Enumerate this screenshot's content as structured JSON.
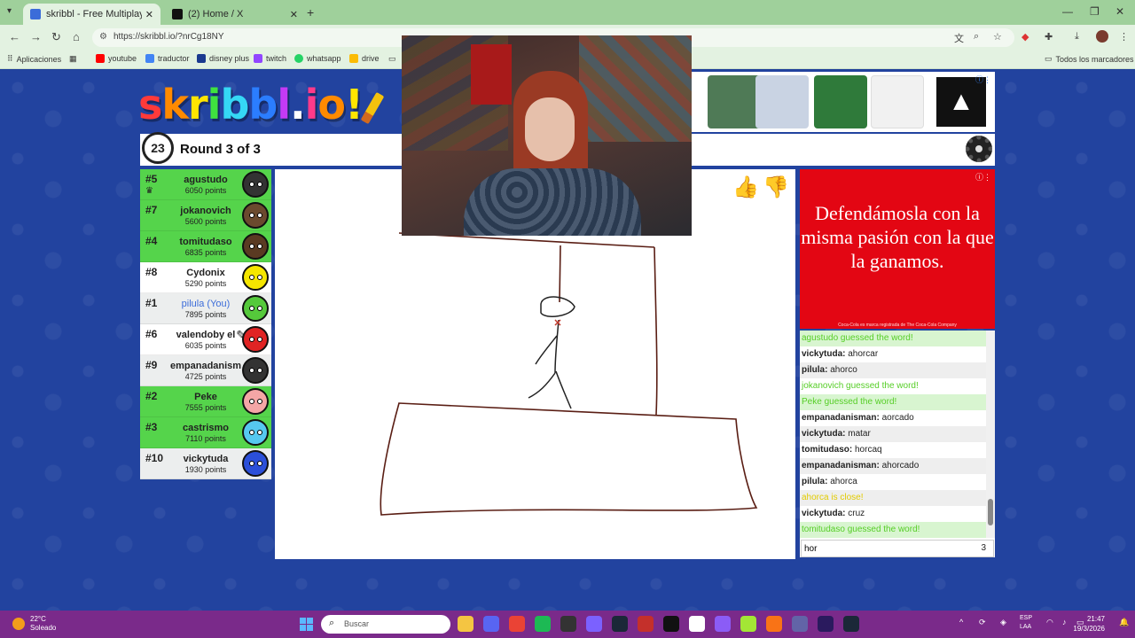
{
  "browser": {
    "tabs": [
      {
        "title": "skribbl - Free Multiplayer D",
        "active": true,
        "icon": "skribbl-favicon"
      },
      {
        "title": "(2) Home / X",
        "active": false,
        "icon": "x-favicon"
      }
    ],
    "new_tab": "+",
    "url": "https://skribbl.io/?nrCg18NY",
    "bookmarks": [
      {
        "label": "Aplicaciones",
        "icon": "apps-icon"
      },
      {
        "label": "youtube",
        "icon": "youtube-icon",
        "color": "#ff0000"
      },
      {
        "label": "traductor",
        "icon": "translate-icon",
        "color": "#4285f4"
      },
      {
        "label": "disney plus",
        "icon": "disney-icon",
        "color": "#1a3a8f"
      },
      {
        "label": "twitch",
        "icon": "twitch-icon",
        "color": "#9146ff"
      },
      {
        "label": "whatsapp",
        "icon": "whatsapp-icon",
        "color": "#25d366"
      },
      {
        "label": "drive",
        "icon": "drive-icon",
        "color": "#fbbc04"
      }
    ],
    "all_bookmarks": "Todos los marcadores"
  },
  "game": {
    "logo": [
      "s",
      "k",
      "r",
      "i",
      "b",
      "b",
      "l",
      ".",
      "i",
      "o",
      "!"
    ],
    "logo_colors": [
      "#ff3a3a",
      "#ff8a00",
      "#ffe500",
      "#3fe23f",
      "#35d8f5",
      "#2b7dff",
      "#c43af5",
      "#ffffff",
      "#ff3a8a",
      "#ff8a00",
      "#ffe500"
    ],
    "timer": "23",
    "round": "Round 3 of 3",
    "players": [
      {
        "rank": "#5",
        "name": "agustudo",
        "points": "6050 points",
        "bg": "green",
        "avatar": "#333333",
        "crown": true
      },
      {
        "rank": "#7",
        "name": "jokanovich",
        "points": "5600 points",
        "bg": "green",
        "avatar": "#6b4a2e"
      },
      {
        "rank": "#4",
        "name": "tomitudaso",
        "points": "6835 points",
        "bg": "green",
        "avatar": "#5a3a22"
      },
      {
        "rank": "#8",
        "name": "Cydonix",
        "points": "5290 points",
        "bg": "white",
        "avatar": "#f5e600"
      },
      {
        "rank": "#1",
        "name": "pilula (You)",
        "points": "7895 points",
        "bg": "grey",
        "avatar": "#55c93b",
        "you": true
      },
      {
        "rank": "#6",
        "name": "valendoby el",
        "points": "6035 points",
        "bg": "white",
        "avatar": "#e02424",
        "drawing": true
      },
      {
        "rank": "#9",
        "name": "empanadanisman",
        "points": "4725 points",
        "bg": "grey",
        "avatar": "#333333"
      },
      {
        "rank": "#2",
        "name": "Peke",
        "points": "7555 points",
        "bg": "green",
        "avatar": "#f4a6a6"
      },
      {
        "rank": "#3",
        "name": "castrismo",
        "points": "7110 points",
        "bg": "green",
        "avatar": "#56c8f0"
      },
      {
        "rank": "#10",
        "name": "vickytuda",
        "points": "1930 points",
        "bg": "grey",
        "avatar": "#2b4fd9"
      }
    ],
    "bubbles": {
      "pilula": "ahorca",
      "vickytuda": "cruz"
    },
    "ad_banner_items": [
      "#4f7a56",
      "#c9d3e3",
      "#2f7a3a",
      "#f1f1f1"
    ],
    "ad": {
      "text": "Defendámosla con la misma pasión con la que la ganamos.",
      "fine_print": "Coca-Cola es marca registrada de The Coca-Cola Company",
      "bg": "#e30613"
    },
    "chat": [
      {
        "type": "guess",
        "text": "agustudo guessed the word!"
      },
      {
        "type": "msg",
        "user": "vickytuda",
        "text": "ahorcar"
      },
      {
        "type": "msg",
        "user": "pilula",
        "text": "ahorco"
      },
      {
        "type": "guess",
        "text": "jokanovich guessed the word!"
      },
      {
        "type": "guess",
        "text": "Peke guessed the word!"
      },
      {
        "type": "msg",
        "user": "empanadanisman",
        "text": "aorcado"
      },
      {
        "type": "msg",
        "user": "vickytuda",
        "text": "matar"
      },
      {
        "type": "msg",
        "user": "tomitudaso",
        "text": "horcaq"
      },
      {
        "type": "msg",
        "user": "empanadanisman",
        "text": "ahorcado"
      },
      {
        "type": "msg",
        "user": "pilula",
        "text": "ahorca"
      },
      {
        "type": "close",
        "text": "ahorca is close!"
      },
      {
        "type": "msg",
        "user": "vickytuda",
        "text": "cruz"
      },
      {
        "type": "guess",
        "text": "tomitudaso guessed the word!"
      }
    ],
    "chat_input": "hor",
    "chat_input_count": "3"
  },
  "taskbar": {
    "temp": "22°C",
    "condition": "Soleado",
    "search": "Buscar",
    "apps": [
      {
        "name": "file-explorer-icon",
        "color": "#f4c542"
      },
      {
        "name": "discord-icon",
        "color": "#5865f2"
      },
      {
        "name": "chrome-icon",
        "color": "#ea4335"
      },
      {
        "name": "spotify-icon",
        "color": "#1db954"
      },
      {
        "name": "obs-icon",
        "color": "#333333"
      },
      {
        "name": "app-icon",
        "color": "#7b61ff"
      },
      {
        "name": "steam-icon",
        "color": "#1b2838"
      },
      {
        "name": "app-icon",
        "color": "#c4302b"
      },
      {
        "name": "capcut-icon",
        "color": "#111111"
      },
      {
        "name": "notion-icon",
        "color": "#ffffff"
      },
      {
        "name": "messenger-icon",
        "color": "#8b5cf6"
      },
      {
        "name": "app-icon",
        "color": "#a3e635"
      },
      {
        "name": "app-icon",
        "color": "#f97316"
      },
      {
        "name": "teams-icon",
        "color": "#6264a7"
      },
      {
        "name": "premiere-icon",
        "color": "#2a1a5e"
      },
      {
        "name": "steam-icon",
        "color": "#1b2838"
      }
    ],
    "lang": "ESP",
    "lang2": "LAA",
    "time": "21:47",
    "date": "19/3/2026"
  }
}
